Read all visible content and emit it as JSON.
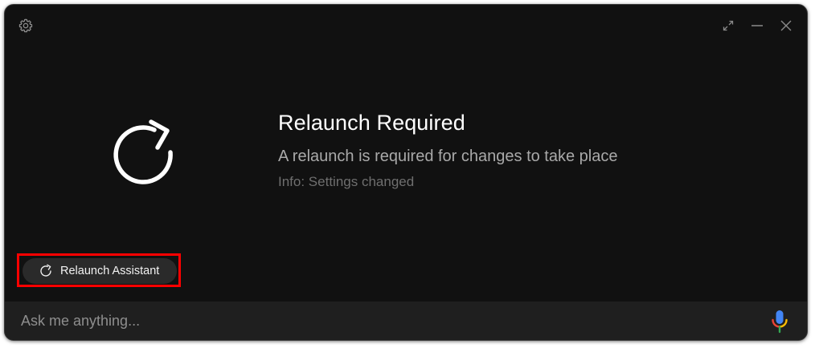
{
  "window": {
    "controls": {
      "settings_icon": "gear-icon",
      "expand_icon": "expand-icon",
      "minimize_icon": "minimize-icon",
      "close_icon": "close-icon"
    }
  },
  "main": {
    "icon": "refresh-icon",
    "title": "Relaunch Required",
    "subtitle": "A relaunch is required for changes to take place",
    "info": "Info: Settings changed"
  },
  "action": {
    "icon": "refresh-icon",
    "label": "Relaunch Assistant",
    "highlight_color": "#ff0000"
  },
  "input": {
    "placeholder": "Ask me anything...",
    "value": "",
    "mic_icon": "microphone-icon"
  },
  "colors": {
    "background": "#111111",
    "input_bar": "#1f1f1f",
    "button": "#2a2a2a",
    "title": "#ffffff",
    "subtitle": "#a9a9a9",
    "info": "#6f6f6f",
    "mic_blue": "#4285f4",
    "mic_red": "#ea4335",
    "mic_yellow": "#fbbc05",
    "mic_green": "#34a853"
  }
}
